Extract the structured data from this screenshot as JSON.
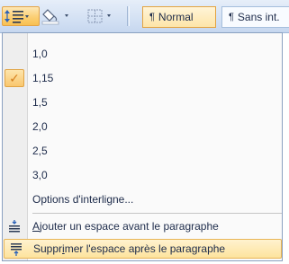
{
  "toolbar": {
    "styles": [
      {
        "pilcrow": "¶",
        "name": "Normal"
      },
      {
        "pilcrow": "¶",
        "name": "Sans int."
      }
    ]
  },
  "menu": {
    "spacing_options": [
      {
        "label": "1,0",
        "checked": false
      },
      {
        "label": "1,15",
        "checked": true
      },
      {
        "label": "1,5",
        "checked": false
      },
      {
        "label": "2,0",
        "checked": false
      },
      {
        "label": "2,5",
        "checked": false
      },
      {
        "label": "3,0",
        "checked": false
      }
    ],
    "options_label": "Options d'interligne...",
    "add_space_before": {
      "pre": "",
      "underlined": "A",
      "post": "jouter un espace avant le paragraphe"
    },
    "remove_space_after": {
      "pre": "Suppr",
      "underlined": "i",
      "post": "mer l'espace après le paragraphe"
    }
  },
  "colors": {
    "accent": "#f9c76e",
    "check": "#d5801f",
    "menu_text": "#1d2b4a"
  }
}
